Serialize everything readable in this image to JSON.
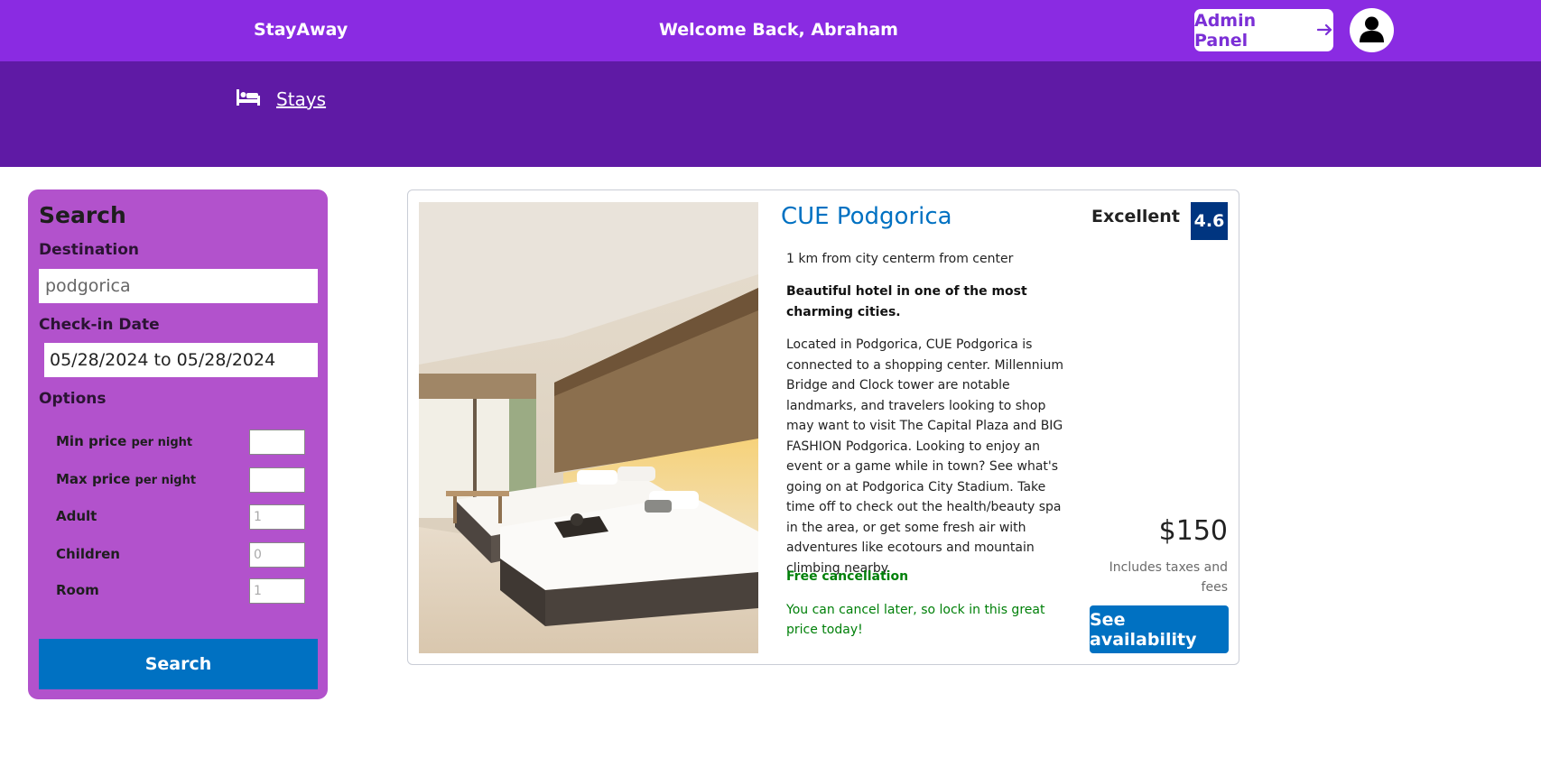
{
  "header": {
    "brand": "StayAway",
    "welcome": "Welcome Back, Abraham",
    "admin_label": "Admin Panel",
    "admin_icon": "arrow-right-icon",
    "avatar_icon": "user-icon"
  },
  "subnav": {
    "stays_label": "Stays",
    "stays_icon": "bed-icon"
  },
  "search": {
    "title": "Search",
    "destination_label": "Destination",
    "destination_value": "podgorica",
    "checkin_label": "Check-in Date",
    "checkin_value": "05/28/2024 to 05/28/2024",
    "options_label": "Options",
    "options": [
      {
        "label": "Min price",
        "suffix": "per night",
        "value": ""
      },
      {
        "label": "Max price",
        "suffix": "per night",
        "value": ""
      },
      {
        "label": "Adult",
        "suffix": "",
        "value": "1"
      },
      {
        "label": "Children",
        "suffix": "",
        "value": "0"
      },
      {
        "label": "Room",
        "suffix": "",
        "value": "1"
      }
    ],
    "button_label": "Search"
  },
  "result": {
    "name": "CUE Podgorica",
    "distance": "1 km from city centerm from center",
    "tagline": "Beautiful hotel in one of the most charming cities.",
    "description": "Located in Podgorica, CUE Podgorica is connected to a shopping center. Millennium Bridge and Clock tower are notable landmarks, and travelers looking to shop may want to visit The Capital Plaza and BIG FASHION Podgorica. Looking to enjoy an event or a game while in town? See what's going on at Podgorica City Stadium. Take time off to check out the health/beauty spa in the area, or get some fresh air with adventures like ecotours and mountain climbing nearby.",
    "free_cancellation": "Free cancellation",
    "cancel_later": "You can cancel later, so lock in this great price today!",
    "rating_text": "Excellent",
    "rating_score": "4.6",
    "price": "$150",
    "price_note": "Includes taxes and fees",
    "availability_label": "See availability"
  },
  "colors": {
    "topbar": "#8a2be2",
    "subheader": "#5f1aa5",
    "search_panel": "#b252cc",
    "primary": "#0071c2",
    "rating_badge": "#003580",
    "green": "#008009"
  }
}
